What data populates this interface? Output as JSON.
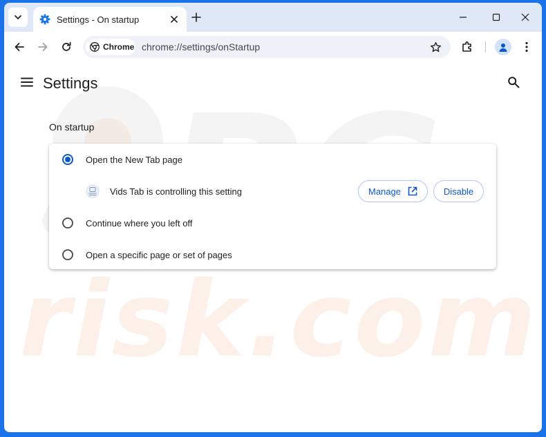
{
  "browser": {
    "tab_title": "Settings - On startup",
    "chip_label": "Chrome",
    "url": "chrome://settings/onStartup"
  },
  "settings": {
    "page_title": "Settings",
    "section_title": "On startup",
    "options": [
      {
        "label": "Open the New Tab page",
        "selected": true
      },
      {
        "label": "Continue where you left off",
        "selected": false
      },
      {
        "label": "Open a specific page or set of pages",
        "selected": false
      }
    ],
    "extension_notice": "Vids Tab is controlling this setting",
    "manage_label": "Manage",
    "disable_label": "Disable"
  },
  "colors": {
    "accent": "#0b57d0",
    "frame": "#dfe8f6",
    "outer": "#1a73e8"
  }
}
